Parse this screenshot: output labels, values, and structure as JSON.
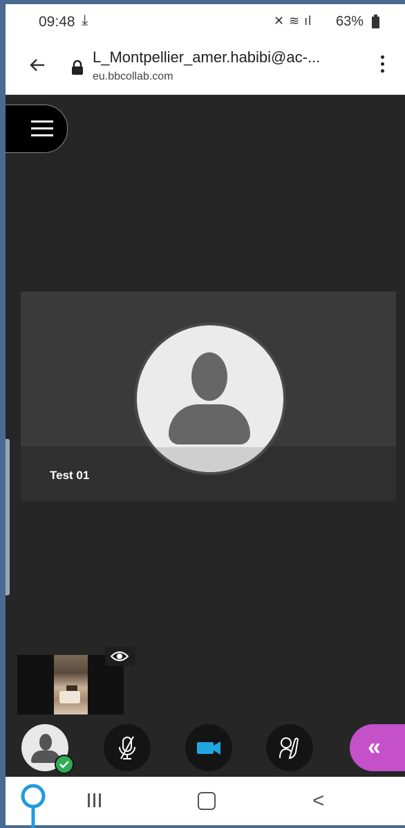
{
  "status": {
    "time": "09:48",
    "battery": "63%",
    "download_icon": "download-icon",
    "signal_icons": "mute-wifi-signal-icons"
  },
  "browser": {
    "title": "L_Montpellier_amer.habibi@ac-...",
    "domain": "eu.bbcollab.com"
  },
  "stage": {
    "participant_name": "Test 01"
  },
  "controls": {
    "collab_glyph": "«"
  },
  "nav": {
    "back_glyph": "<"
  },
  "colors": {
    "accent_purple": "#c451c9",
    "camera_blue": "#1fa6e0",
    "check_green": "#2faa55",
    "background": "#262626"
  }
}
